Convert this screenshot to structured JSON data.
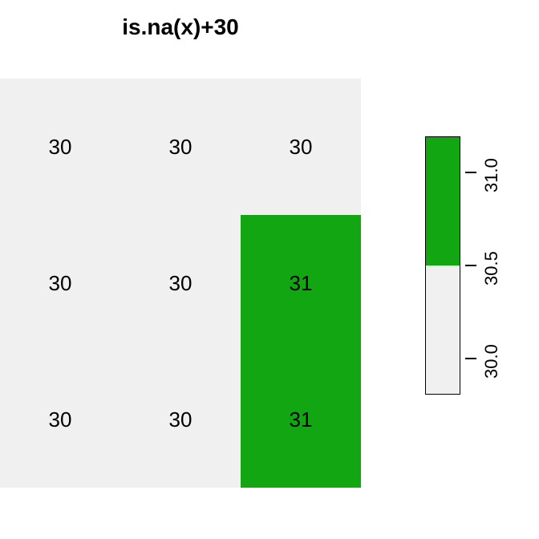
{
  "chart_data": {
    "type": "heatmap",
    "title": "is.na(x)+30",
    "rows": 3,
    "cols": 3,
    "values": [
      [
        30,
        30,
        30
      ],
      [
        30,
        30,
        31
      ],
      [
        30,
        30,
        31
      ]
    ],
    "value_range": [
      30,
      31
    ],
    "color_low": "#f0f0f0",
    "color_high": "#13a613",
    "legend_ticks": [
      30.0,
      30.5,
      31.0
    ],
    "legend_tick_labels": [
      "30.0",
      "30.5",
      "31.0"
    ]
  }
}
